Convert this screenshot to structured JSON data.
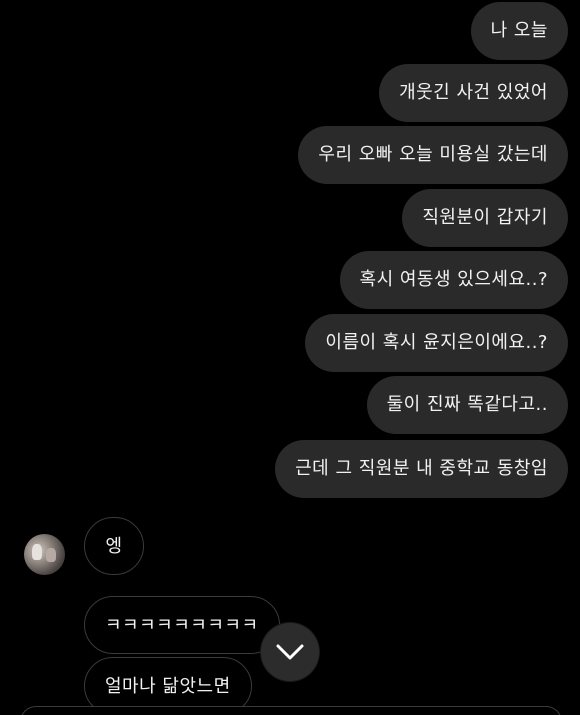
{
  "messages": {
    "sent": [
      "나 오늘",
      "개웃긴 사건 있었어",
      "우리 오빠 오늘 미용실 갔는데",
      "직원분이 갑자기",
      "혹시 여동생 있으세요..?",
      "이름이 혹시 윤지은이에요..?",
      "둘이 진짜 똑같다고..",
      "근데 그 직원분 내 중학교 동창임"
    ],
    "received": [
      "엥",
      "ㅋㅋㅋㅋㅋㅋㅋㅋㅋ",
      "얼마나 닮앗느면"
    ]
  },
  "icons": {
    "scroll_down": "chevron-down-icon",
    "avatar": "avatar-image"
  },
  "colors": {
    "background": "#000000",
    "sent_bubble": "#2a2a2a",
    "received_bubble_border": "#3a3a3a",
    "text": "#f2f2f2"
  }
}
